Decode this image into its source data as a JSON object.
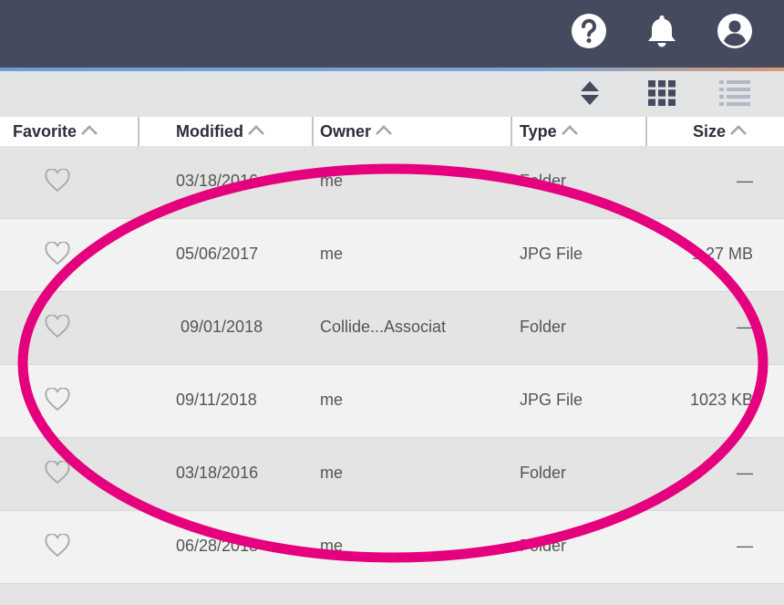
{
  "topbar": {
    "icons": [
      "help-icon",
      "bell-icon",
      "account-icon"
    ]
  },
  "toolbar": {
    "icons": [
      "sort-icon",
      "grid-view-icon",
      "list-view-icon"
    ]
  },
  "columns": {
    "favorite": "Favorite",
    "modified": "Modified",
    "owner": "Owner",
    "type": "Type",
    "size": "Size"
  },
  "rows": [
    {
      "modified": "03/18/2016",
      "owner": "me",
      "type": "Folder",
      "size": "—"
    },
    {
      "modified": "05/06/2017",
      "owner": "me",
      "type": "JPG File",
      "size": "1.27 MB"
    },
    {
      "modified": "09/01/2018",
      "owner": "Collide...Associat",
      "type": "Folder",
      "size": "—"
    },
    {
      "modified": "09/11/2018",
      "owner": "me",
      "type": "JPG File",
      "size": "1023 KB"
    },
    {
      "modified": "03/18/2016",
      "owner": "me",
      "type": "Folder",
      "size": "—"
    },
    {
      "modified": "06/28/2018",
      "owner": "me",
      "type": "Folder",
      "size": "—"
    }
  ],
  "colors": {
    "topbar": "#454a5e",
    "annotation": "#e5007e"
  }
}
